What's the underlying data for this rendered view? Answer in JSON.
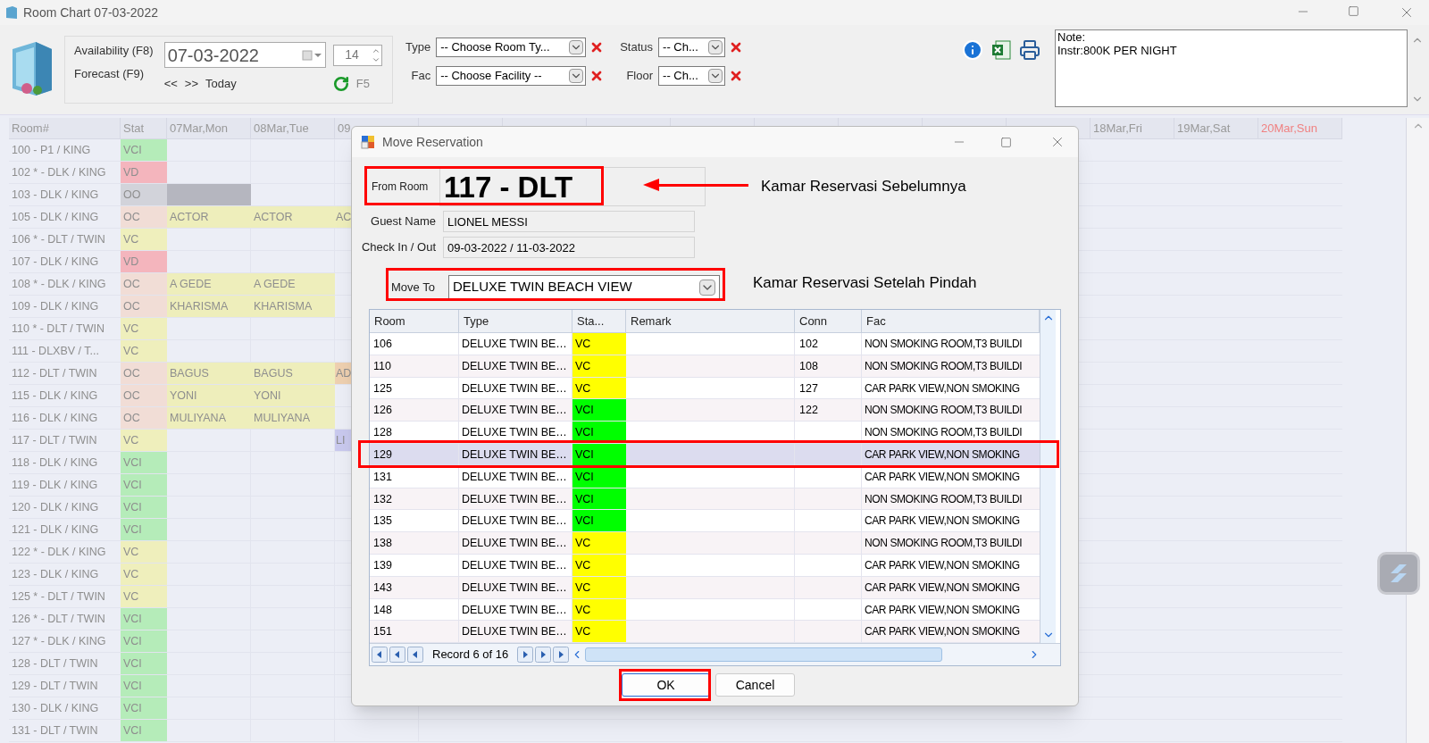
{
  "window": {
    "title": "Room Chart 07-03-2022"
  },
  "toolbar": {
    "modes": [
      "Availability (F8)",
      "Forecast (F9)"
    ],
    "date": "07-03-2022",
    "days": "14",
    "nav": [
      "<<",
      ">>",
      "Today"
    ],
    "refresh_key": "F5",
    "filters": [
      {
        "label": "Type",
        "value": "-- Choose Room Ty..."
      },
      {
        "label": "Status",
        "value": "-- Ch..."
      },
      {
        "label": "Fac",
        "value": "-- Choose Facility --"
      },
      {
        "label": "Floor",
        "value": "-- Ch..."
      }
    ],
    "note": [
      "Note:",
      "Instr:800K PER NIGHT"
    ]
  },
  "grid": {
    "columns": [
      "Room#",
      "Stat"
    ],
    "dates_left": [
      {
        "label": "07Mar,Mon",
        "weekend": false
      },
      {
        "label": "08Mar,Tue",
        "weekend": false
      },
      {
        "label": "09",
        "weekend": false
      }
    ],
    "dates_right": [
      {
        "label": "18Mar,Fri",
        "weekend": false
      },
      {
        "label": "19Mar,Sat",
        "weekend": false
      },
      {
        "label": "20Mar,Sun",
        "weekend": true
      }
    ],
    "rows": [
      {
        "room": "100 - P1 / KING",
        "status": "VCI",
        "color": "#b5ecb9"
      },
      {
        "room": "102 * - DLK / KING",
        "status": "VD",
        "color": "#f4b5bd"
      },
      {
        "room": "103 - DLK / KING",
        "status": "OO",
        "color": "#d2d3da",
        "cells": [
          {
            "kind": "block",
            "color": "#b5b6bf"
          }
        ]
      },
      {
        "room": "105 - DLK / KING",
        "status": "OC",
        "color": "#f1ddd6",
        "cells": [
          {
            "kind": "booking",
            "guest": "ACTOR",
            "color": "#eeeebb"
          },
          {
            "kind": "booking",
            "guest": "ACTOR",
            "color": "#eeeebb"
          },
          {
            "kind": "booking",
            "guest": "AC",
            "color": "#eeeebb"
          }
        ]
      },
      {
        "room": "106 * - DLT / TWIN",
        "status": "VC",
        "color": "#efefbc"
      },
      {
        "room": "107 - DLK / KING",
        "status": "VD",
        "color": "#f4b5bd"
      },
      {
        "room": "108 * - DLK / KING",
        "status": "OC",
        "color": "#f1ddd6",
        "cells": [
          {
            "kind": "booking",
            "guest": "A GEDE",
            "color": "#eeeebb"
          },
          {
            "kind": "booking",
            "guest": "A GEDE",
            "color": "#eeeebb"
          }
        ]
      },
      {
        "room": "109 - DLK / KING",
        "status": "OC",
        "color": "#f1ddd6",
        "cells": [
          {
            "kind": "booking",
            "guest": "KHARISMA",
            "color": "#eeeebb"
          },
          {
            "kind": "booking",
            "guest": "KHARISMA",
            "color": "#eeeebb"
          }
        ]
      },
      {
        "room": "110 * - DLT / TWIN",
        "status": "VC",
        "color": "#efefbc"
      },
      {
        "room": "111 - DLXBV / T...",
        "status": "VC",
        "color": "#efefbc"
      },
      {
        "room": "112 - DLT / TWIN",
        "status": "OC",
        "color": "#f1ddd6",
        "cells": [
          {
            "kind": "booking",
            "guest": "BAGUS",
            "color": "#eeeebb"
          },
          {
            "kind": "booking",
            "guest": "BAGUS",
            "color": "#eeeebb"
          },
          {
            "kind": "booking",
            "guest": "AD",
            "color": "#eed0b0"
          }
        ]
      },
      {
        "room": "115 - DLK / KING",
        "status": "OC",
        "color": "#f1ddd6",
        "cells": [
          {
            "kind": "booking",
            "guest": "YONI",
            "color": "#eeeebb"
          },
          {
            "kind": "booking",
            "guest": "YONI",
            "color": "#eeeebb"
          }
        ]
      },
      {
        "room": "116 - DLK / KING",
        "status": "OC",
        "color": "#f1ddd6",
        "cells": [
          {
            "kind": "booking",
            "guest": "MULIYANA",
            "color": "#eeeebb"
          },
          {
            "kind": "booking",
            "guest": "MULIYANA",
            "color": "#eeeebb"
          }
        ]
      },
      {
        "room": "117 - DLT / TWIN",
        "status": "VC",
        "color": "#efefbc",
        "cells": [
          {
            "kind": "empty"
          },
          {
            "kind": "empty"
          },
          {
            "kind": "booking",
            "guest": "LI",
            "color": "#c9c9ee"
          }
        ]
      },
      {
        "room": "118 - DLK / KING",
        "status": "VCI",
        "color": "#b5ecb9"
      },
      {
        "room": "119 - DLK / KING",
        "status": "VCI",
        "color": "#b5ecb9"
      },
      {
        "room": "120 - DLK / KING",
        "status": "VCI",
        "color": "#b5ecb9"
      },
      {
        "room": "121 - DLK / KING",
        "status": "VCI",
        "color": "#b5ecb9"
      },
      {
        "room": "122 * - DLK / KING",
        "status": "VC",
        "color": "#efefbc"
      },
      {
        "room": "123 - DLK / KING",
        "status": "VC",
        "color": "#efefbc"
      },
      {
        "room": "125 * - DLT / TWIN",
        "status": "VC",
        "color": "#efefbc"
      },
      {
        "room": "126 * - DLT / TWIN",
        "status": "VCI",
        "color": "#b5ecb9"
      },
      {
        "room": "127 * - DLK / KING",
        "status": "VCI",
        "color": "#b5ecb9"
      },
      {
        "room": "128 - DLT / TWIN",
        "status": "VCI",
        "color": "#b5ecb9"
      },
      {
        "room": "129 - DLT / TWIN",
        "status": "VCI",
        "color": "#b5ecb9"
      },
      {
        "room": "130 - DLK / KING",
        "status": "VCI",
        "color": "#b5ecb9"
      },
      {
        "room": "131 - DLT / TWIN",
        "status": "VCI",
        "color": "#b5ecb9"
      }
    ]
  },
  "dialog": {
    "title": "Move Reservation",
    "from_room": {
      "label": "From Room",
      "value": "117 - DLT"
    },
    "fields": [
      {
        "label": "Guest Name",
        "value": "LIONEL MESSI"
      },
      {
        "label": "Check In / Out",
        "value": "09-03-2022 / 11-03-2022"
      }
    ],
    "move_to": {
      "label": "Move To",
      "value": "DELUXE TWIN BEACH VIEW"
    },
    "table": {
      "columns": [
        "Room",
        "Type",
        "Sta...",
        "Remark",
        "Conn",
        "Fac"
      ],
      "rows": [
        {
          "room": "106",
          "type": "DELUXE TWIN BE…",
          "status": "VC",
          "color": "#ffff00",
          "conn": "102",
          "fac": "NON SMOKING ROOM,T3 BUILDI",
          "selected": false
        },
        {
          "room": "110",
          "type": "DELUXE TWIN BE…",
          "status": "VC",
          "color": "#ffff00",
          "conn": "108",
          "fac": "NON SMOKING ROOM,T3 BUILDI",
          "selected": false
        },
        {
          "room": "125",
          "type": "DELUXE TWIN BE…",
          "status": "VC",
          "color": "#ffff00",
          "conn": "127",
          "fac": "CAR PARK VIEW,NON SMOKING",
          "selected": false
        },
        {
          "room": "126",
          "type": "DELUXE TWIN BE…",
          "status": "VCI",
          "color": "#00ff00",
          "conn": "122",
          "fac": "NON SMOKING ROOM,T3 BUILDI",
          "selected": false
        },
        {
          "room": "128",
          "type": "DELUXE TWIN BE…",
          "status": "VCI",
          "color": "#00ff00",
          "fac": "NON SMOKING ROOM,T3 BUILDI",
          "selected": false
        },
        {
          "room": "129",
          "type": "DELUXE TWIN BE…",
          "status": "VCI",
          "color": "#00ff00",
          "fac": "CAR PARK VIEW,NON SMOKING",
          "selected": true
        },
        {
          "room": "131",
          "type": "DELUXE TWIN BE…",
          "status": "VCI",
          "color": "#00ff00",
          "fac": "CAR PARK VIEW,NON SMOKING",
          "selected": false
        },
        {
          "room": "132",
          "type": "DELUXE TWIN BE…",
          "status": "VCI",
          "color": "#00ff00",
          "fac": "NON SMOKING ROOM,T3 BUILDI",
          "selected": false
        },
        {
          "room": "135",
          "type": "DELUXE TWIN BE…",
          "status": "VCI",
          "color": "#00ff00",
          "fac": "CAR PARK VIEW,NON SMOKING",
          "selected": false
        },
        {
          "room": "138",
          "type": "DELUXE TWIN BE…",
          "status": "VC",
          "color": "#ffff00",
          "fac": "NON SMOKING ROOM,T3 BUILDI",
          "selected": false
        },
        {
          "room": "139",
          "type": "DELUXE TWIN BE…",
          "status": "VC",
          "color": "#ffff00",
          "fac": "CAR PARK VIEW,NON SMOKING",
          "selected": false
        },
        {
          "room": "143",
          "type": "DELUXE TWIN BE…",
          "status": "VC",
          "color": "#ffff00",
          "fac": "CAR PARK VIEW,NON SMOKING",
          "selected": false
        },
        {
          "room": "148",
          "type": "DELUXE TWIN BE…",
          "status": "VC",
          "color": "#ffff00",
          "fac": "CAR PARK VIEW,NON SMOKING",
          "selected": false
        },
        {
          "room": "151",
          "type": "DELUXE TWIN BE…",
          "status": "VC",
          "color": "#ffff00",
          "fac": "CAR PARK VIEW,NON SMOKING",
          "selected": false
        }
      ],
      "pager": "Record 6 of 16"
    },
    "buttons": [
      {
        "label": "OK",
        "focused": true
      },
      {
        "label": "Cancel",
        "focused": false
      }
    ]
  },
  "annotations": [
    "Kamar Reservasi Sebelumnya",
    "Kamar Reservasi Setelah Pindah"
  ]
}
